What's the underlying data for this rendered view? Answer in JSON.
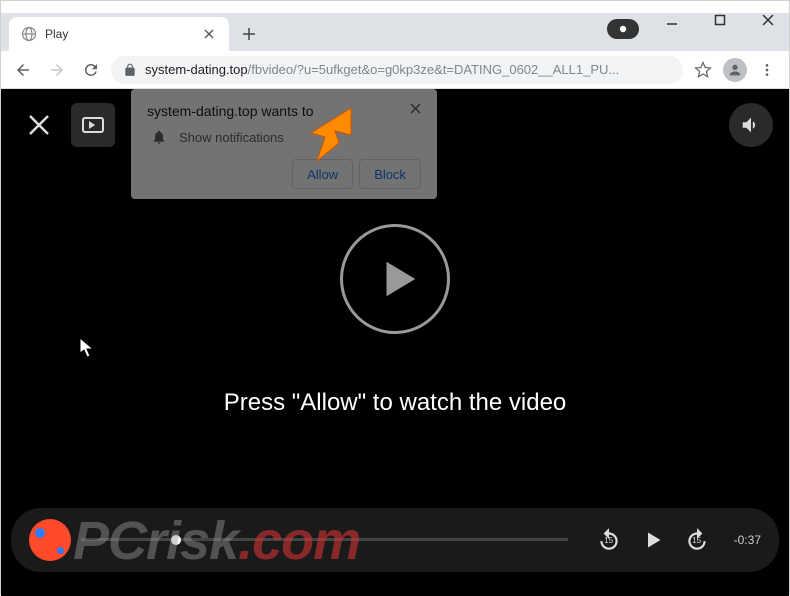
{
  "window": {
    "tab_title": "Play"
  },
  "address": {
    "domain": "system-dating.top",
    "path": "/fbvideo/?u=5ufkget&o=g0kp3ze&t=DATING_0602__ALL1_PU..."
  },
  "notification": {
    "host_wants": "system-dating.top wants to",
    "permission": "Show notifications",
    "allow": "Allow",
    "block": "Block"
  },
  "player": {
    "prompt": "Press \"Allow\" to watch the video",
    "time_remaining": "-0:37",
    "skip_back": "15",
    "skip_fwd": "15"
  },
  "watermark": {
    "brand": "PCrisk",
    "ext": ".com"
  },
  "colors": {
    "arrow": "#ff8a00"
  }
}
